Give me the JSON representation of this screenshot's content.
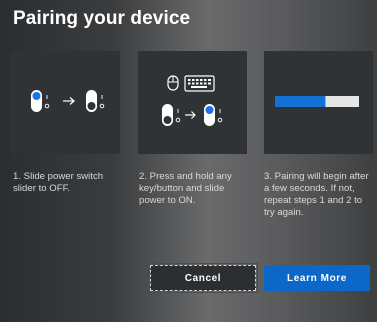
{
  "dialog": {
    "title": "Pairing your device"
  },
  "steps": [
    {
      "text": "1. Slide power switch slider to OFF."
    },
    {
      "text": "2. Press and hold any key/button and slide power to ON."
    },
    {
      "text": "3. Pairing will begin after a few seconds. If not, repeat steps 1 and 2 to try again."
    }
  ],
  "illustrations": {
    "step1": [
      "power-switch-on-icon",
      "arrow-right-icon",
      "power-switch-off-icon"
    ],
    "step2": [
      "mouse-icon",
      "keyboard-icon",
      "power-switch-off-icon",
      "arrow-right-icon",
      "power-switch-on-icon"
    ],
    "step3": [
      "pairing-progress-bar"
    ]
  },
  "progress": {
    "fraction": 0.6,
    "fill_color": "#1273d4",
    "track_color": "#e6e6e6"
  },
  "colors": {
    "accent": "#0b68c8",
    "switch_on": "#1a73e8"
  },
  "buttons": {
    "cancel_label": "Cancel",
    "learn_more_label": "Learn More"
  }
}
